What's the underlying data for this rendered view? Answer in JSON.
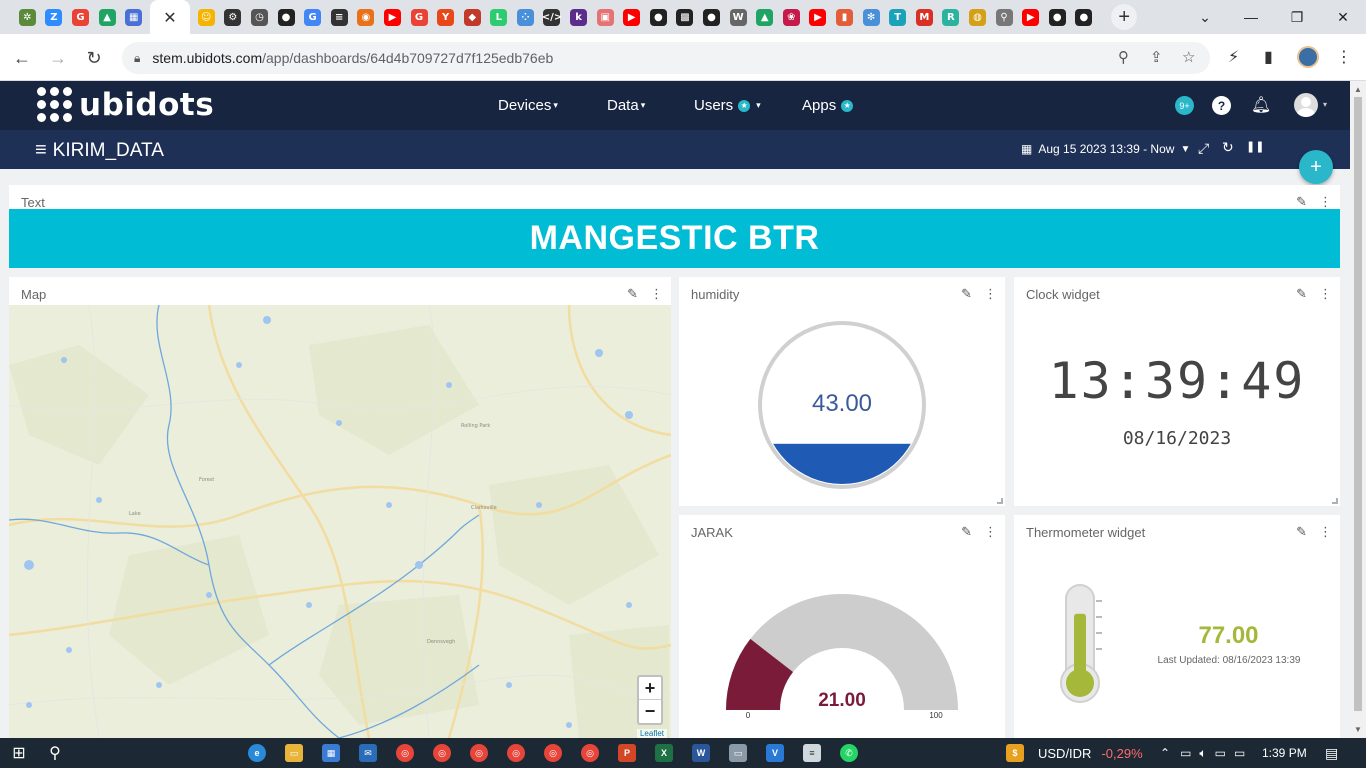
{
  "browser": {
    "url_host": "stem.ubidots.com",
    "url_path": "/app/dashboards/64d4b709727d7f125edb76eb",
    "tab_icons": [
      {
        "name": "pinwheel-icon",
        "color": "#5a8a3a",
        "glyph": "✲"
      },
      {
        "name": "zoom-icon",
        "color": "#2d8cff",
        "glyph": "Z"
      },
      {
        "name": "google-icon",
        "color": "#ea4335",
        "glyph": "G"
      },
      {
        "name": "drive-icon",
        "color": "#1fa463",
        "glyph": "▲"
      },
      {
        "name": "grid-icon",
        "color": "#4a6fd6",
        "glyph": "▦"
      },
      {
        "name": "close-icon",
        "color": "",
        "glyph": "✕",
        "active": true
      },
      {
        "name": "emoji-icon",
        "color": "#f4b400",
        "glyph": "☺"
      },
      {
        "name": "robot-icon",
        "color": "#333333",
        "glyph": "⚙"
      },
      {
        "name": "history-icon",
        "color": "#555555",
        "glyph": "◷"
      },
      {
        "name": "github-icon",
        "color": "#222222",
        "glyph": "●"
      },
      {
        "name": "google-icon",
        "color": "#4285f4",
        "glyph": "G"
      },
      {
        "name": "doc-icon",
        "color": "#333333",
        "glyph": "≡"
      },
      {
        "name": "basketball-icon",
        "color": "#e8711a",
        "glyph": "◉"
      },
      {
        "name": "youtube-icon",
        "color": "#ff0000",
        "glyph": "▶"
      },
      {
        "name": "google-icon",
        "color": "#ea4335",
        "glyph": "G"
      },
      {
        "name": "y-icon",
        "color": "#e8471a",
        "glyph": "Y"
      },
      {
        "name": "cube-icon",
        "color": "#c0392b",
        "glyph": "◆"
      },
      {
        "name": "l-icon",
        "color": "#2ecc71",
        "glyph": "L"
      },
      {
        "name": "dots-icon",
        "color": "#4a90d9",
        "glyph": "⁘"
      },
      {
        "name": "code-icon",
        "color": "#333333",
        "glyph": "</>"
      },
      {
        "name": "k-icon",
        "color": "#5b2c8a",
        "glyph": "k"
      },
      {
        "name": "gift-icon",
        "color": "#e57373",
        "glyph": "▣"
      },
      {
        "name": "youtube-icon",
        "color": "#ff0000",
        "glyph": "▶"
      },
      {
        "name": "github-icon",
        "color": "#222222",
        "glyph": "●"
      },
      {
        "name": "qr-icon",
        "color": "#222222",
        "glyph": "▩"
      },
      {
        "name": "github-icon",
        "color": "#222222",
        "glyph": "●"
      },
      {
        "name": "wikipedia-icon",
        "color": "#666666",
        "glyph": "W"
      },
      {
        "name": "drive-icon",
        "color": "#1fa463",
        "glyph": "▲"
      },
      {
        "name": "raspberry-icon",
        "color": "#c51a4a",
        "glyph": "❀"
      },
      {
        "name": "youtube-icon",
        "color": "#ff0000",
        "glyph": "▶"
      },
      {
        "name": "bag-icon",
        "color": "#e35d3a",
        "glyph": "▮"
      },
      {
        "name": "atom-icon",
        "color": "#4a90d9",
        "glyph": "✻"
      },
      {
        "name": "t-icon",
        "color": "#1aa3b8",
        "glyph": "T"
      },
      {
        "name": "gmail-icon",
        "color": "#d93025",
        "glyph": "M"
      },
      {
        "name": "r-icon",
        "color": "#2bb3a0",
        "glyph": "R"
      },
      {
        "name": "bee-icon",
        "color": "#d4a017",
        "glyph": "◍"
      },
      {
        "name": "search-icon",
        "color": "#777777",
        "glyph": "⚲"
      },
      {
        "name": "youtube-icon",
        "color": "#ff0000",
        "glyph": "▶"
      },
      {
        "name": "github-icon",
        "color": "#222222",
        "glyph": "●"
      },
      {
        "name": "github-icon",
        "color": "#222222",
        "glyph": "●"
      }
    ]
  },
  "header": {
    "brand": "ubidots",
    "menu": [
      "Devices",
      "Data",
      "Users",
      "Apps"
    ],
    "notification_badge": "9+",
    "help_label": "?"
  },
  "subheader": {
    "dashboard_name": "KIRIM_DATA",
    "date_range": "Aug 15 2023 13:39 - Now"
  },
  "widgets": {
    "text": {
      "title": "Text",
      "content": "MANGESTIC BTR",
      "bg_color": "#00bcd4"
    },
    "map": {
      "title": "Map",
      "zoom_in": "+",
      "zoom_out": "−",
      "attribution": "Leaflet",
      "places": [
        "Clarksville",
        "Dennsvegh",
        "Rolling Park",
        "Forest",
        "Lake"
      ]
    },
    "humidity": {
      "title": "humidity",
      "value": "43.00",
      "fill_fraction": 0.43,
      "fill_color": "#1f5bb5"
    },
    "clock": {
      "title": "Clock widget",
      "time": "13:39:49",
      "date": "08/16/2023"
    },
    "jarak": {
      "title": "JARAK",
      "value": "21.00",
      "value_num": 21,
      "min": "0",
      "max": "100",
      "color": "#7b1b3a"
    },
    "thermometer": {
      "title": "Thermometer widget",
      "value": "77.00",
      "value_num": 77,
      "last_updated": "Last Updated: 08/16/2023 13:39",
      "color": "#a6b83a"
    }
  },
  "taskbar": {
    "currency": "USD/IDR",
    "change": "-0,29%",
    "time": "1:39 PM"
  }
}
